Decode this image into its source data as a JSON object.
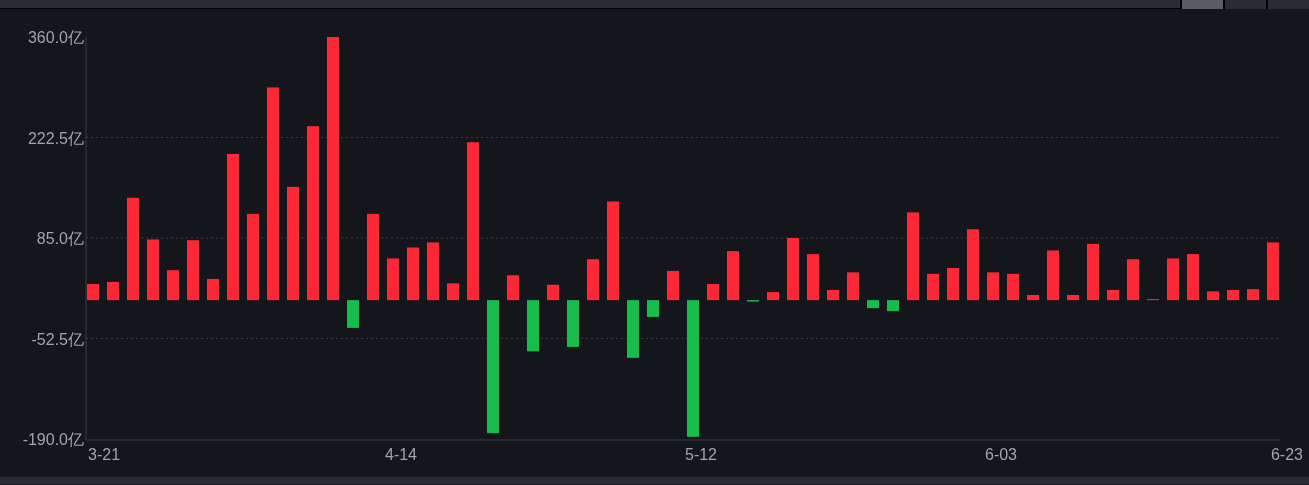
{
  "tabs": [
    {
      "selected": true
    },
    {
      "selected": false
    },
    {
      "selected": false
    }
  ],
  "chart": {
    "chart_data": {
      "type": "bar",
      "stacked": true,
      "grid": true,
      "ylim": [
        -190,
        360
      ],
      "yticks": [
        {
          "value": 360,
          "label": "360.0亿"
        },
        {
          "value": 222.5,
          "label": "222.5亿"
        },
        {
          "value": 85,
          "label": "85.0亿"
        },
        {
          "value": -52.5,
          "label": "-52.5亿"
        },
        {
          "value": -190,
          "label": "-190.0亿"
        }
      ],
      "categories": [
        "3-21",
        null,
        null,
        null,
        null,
        null,
        null,
        null,
        null,
        null,
        null,
        null,
        null,
        null,
        null,
        "4-14",
        null,
        null,
        null,
        null,
        null,
        null,
        null,
        null,
        null,
        null,
        null,
        null,
        null,
        null,
        "5-12",
        null,
        null,
        null,
        null,
        null,
        null,
        null,
        null,
        null,
        null,
        null,
        null,
        null,
        null,
        "6-03",
        null,
        null,
        null,
        null,
        null,
        null,
        null,
        null,
        null,
        null,
        null,
        null,
        null,
        "6-23"
      ],
      "series": [
        {
          "color": "#fc2836",
          "values": [
            22,
            25,
            140,
            83,
            41,
            82,
            29,
            200,
            118,
            291,
            155,
            238,
            360,
            null,
            118,
            57,
            72,
            79,
            23,
            216,
            null,
            34,
            null,
            21,
            null,
            56,
            135,
            null,
            null,
            40,
            null,
            22,
            67,
            null,
            11,
            85,
            63,
            14,
            38,
            null,
            null,
            120,
            36,
            44,
            97,
            38,
            36,
            7,
            68,
            7,
            77,
            14,
            56,
            1,
            57,
            63,
            12,
            14,
            15,
            79
          ]
        },
        {
          "color": "#16bd4c",
          "values": [
            null,
            null,
            null,
            null,
            null,
            null,
            null,
            null,
            null,
            null,
            null,
            null,
            null,
            -38,
            null,
            null,
            null,
            null,
            null,
            null,
            -182,
            null,
            -70,
            null,
            -64,
            null,
            null,
            -79,
            -23,
            null,
            -187,
            null,
            null,
            -2,
            null,
            null,
            null,
            null,
            null,
            -11,
            -15,
            null,
            null,
            null,
            null,
            null,
            null,
            null,
            null,
            null,
            null,
            null,
            null,
            null,
            null,
            null,
            null,
            null,
            null,
            null
          ]
        }
      ]
    }
  }
}
